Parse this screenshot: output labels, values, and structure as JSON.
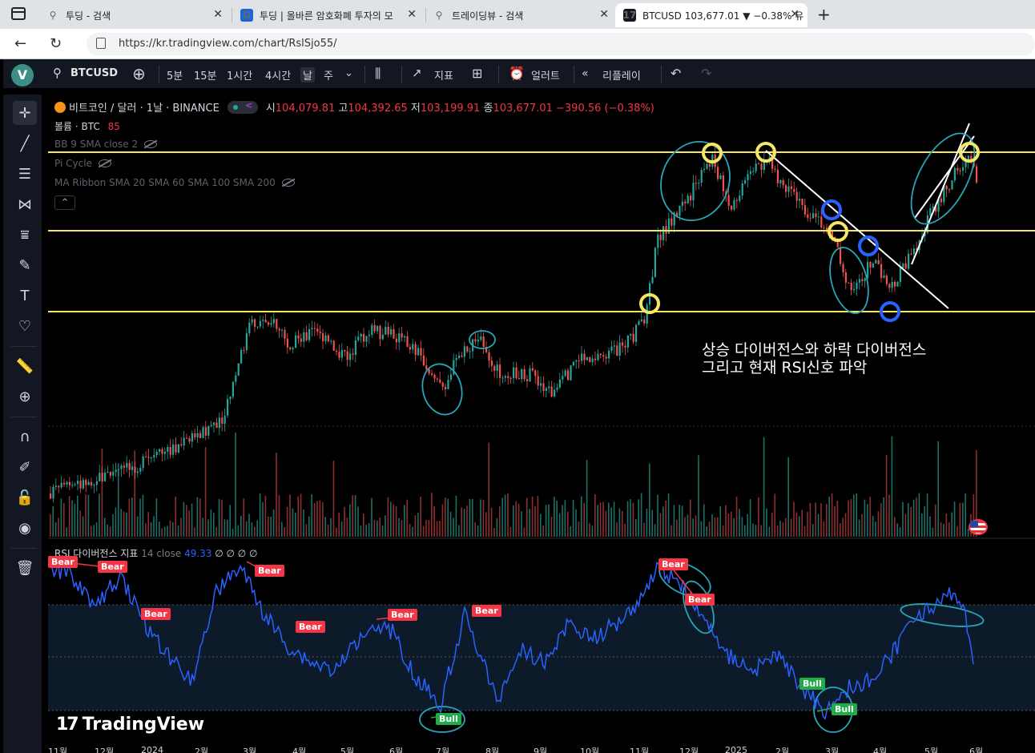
{
  "browser": {
    "tabs": [
      {
        "title": "투딩 - 검색",
        "icon": "search-icon"
      },
      {
        "title": "투딩 | 올바른 암호화폐 투자의 모",
        "icon": "D"
      },
      {
        "title": "트레이딩뷰 - 검색",
        "icon": "search-icon"
      },
      {
        "title": "BTCUSD 103,677.01 ▼ −0.38% 유",
        "icon": "17"
      }
    ],
    "close_glyph": "✕",
    "new_tab_glyph": "+",
    "url": "https://kr.tradingview.com/chart/RslSjo55/"
  },
  "toolbar": {
    "logo": "V",
    "symbol": "BTCUSD",
    "intervals": [
      "5분",
      "15분",
      "1시간",
      "4시간",
      "날",
      "주"
    ],
    "selected_interval": "날",
    "indicators_label": "지표",
    "alert_label": "얼러트",
    "replay_label": "리플레이"
  },
  "legend": {
    "title": "비트코인 / 달러 · 1날 · BINANCE",
    "open_label": "시",
    "open": "104,079.81",
    "high_label": "고",
    "high": "104,392.65",
    "low_label": "저",
    "low": "103,199.91",
    "close_label": "종",
    "close": "103,677.01",
    "change": "−390.56 (−0.38%)",
    "volume_label": "볼륨 · BTC",
    "volume_value": "85",
    "indicator_1": "BB 9 SMA close 2",
    "indicator_2": "Pi Cycle",
    "indicator_3": "MA Ribbon SMA 20 SMA 60 SMA 100 SMA 200",
    "collapse": "^"
  },
  "rsi": {
    "title": "RSI 다이버전스 지표",
    "params": "14 close",
    "value": "49.33",
    "extras": "∅ ∅ ∅ ∅"
  },
  "signals": [
    {
      "type": "bear",
      "label": "Bear"
    },
    {
      "type": "bear",
      "label": "Bear"
    },
    {
      "type": "bear",
      "label": "Bear"
    },
    {
      "type": "bear",
      "label": "Bear"
    },
    {
      "type": "bear",
      "label": "Bear"
    },
    {
      "type": "bear",
      "label": "Bear"
    },
    {
      "type": "bear",
      "label": "Bear"
    },
    {
      "type": "bear",
      "label": "Bear"
    },
    {
      "type": "bear",
      "label": "Bear"
    },
    {
      "type": "bull",
      "label": "Bull"
    },
    {
      "type": "bull",
      "label": "Bull"
    },
    {
      "type": "bull",
      "label": "Bull"
    }
  ],
  "annotation": {
    "line1": "상승 다이버전스와 하락 다이버전스",
    "line2": "그리고 현재 RSI신호 파악"
  },
  "watermark": "TradingView",
  "time_axis": [
    "11월",
    "12월",
    "2024",
    "2월",
    "3월",
    "4월",
    "5월",
    "6월",
    "7월",
    "8월",
    "9월",
    "10월",
    "11월",
    "12월",
    "2025",
    "2월",
    "3월",
    "4월",
    "5월",
    "6월"
  ],
  "colors": {
    "candle_up": "#26a69a",
    "candle_down": "#ef5350",
    "level_line": "#f5e663",
    "circle_yellow": "#f5e663",
    "circle_blue": "#2962ff",
    "freehand": "#26a6b8",
    "rsi_line": "#2962ff",
    "bear": "#f23645",
    "bull": "#22ab4a"
  }
}
